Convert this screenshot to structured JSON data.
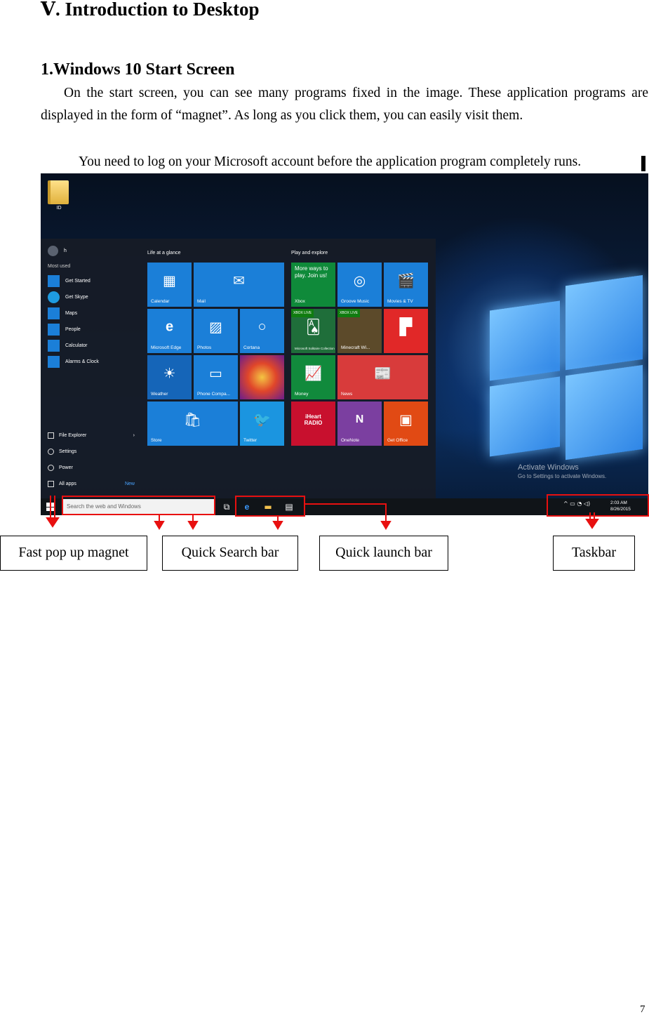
{
  "heading": "Ⅴ. Introduction to Desktop",
  "section_title": "1.Windows 10 Start Screen",
  "paragraph": "On the start screen, you can see many programs fixed in the image. These application programs are displayed in the form of “magnet”. As long as you click them, you can easily visit them.",
  "note": "You need to log on your Microsoft account before the application program completely runs.",
  "screenshot": {
    "desktop_icon_label": "ID",
    "user_name": "h",
    "most_used_title": "Most used",
    "most_used": [
      "Get Started",
      "Get Skype",
      "Maps",
      "People",
      "Calculator",
      "Alarms & Clock"
    ],
    "system_items": [
      "File Explorer",
      "Settings",
      "Power",
      "All apps"
    ],
    "new_label": "New",
    "group_life": "Life at a glance",
    "group_play": "Play and explore",
    "tiles": {
      "calendar": "Calendar",
      "mail": "Mail",
      "edge": "Microsoft Edge",
      "photos": "Photos",
      "cortana": "Cortana",
      "weather": "Weather",
      "phone": "Phone Compa...",
      "store": "Store",
      "twitter": "Twitter",
      "xbox_title": "More ways to play. Join us!",
      "xbox": "Xbox",
      "groove": "Groove Music",
      "movies": "Movies & TV",
      "solitaire": "Microsoft Solitaire Collection",
      "minecraft": "Minecraft Wi...",
      "money": "Money",
      "news": "News",
      "iheart": "iHeart RADIO",
      "onenote": "OneNote",
      "office": "Get Office",
      "xbox_live": "XBOX LIVE"
    },
    "search_placeholder": "Search the web and Windows",
    "activate_title": "Activate Windows",
    "activate_sub": "Go to Settings to activate Windows.",
    "clock_time": "2:03 AM",
    "clock_date": "8/26/2015"
  },
  "callouts": {
    "fast_popup": "Fast pop up magnet",
    "quick_search": "Quick Search bar",
    "quick_launch": "Quick launch bar",
    "taskbar": "Taskbar"
  },
  "page_number": "7",
  "colors": {
    "annotation_red": "#e81010",
    "tile_blue": "#1b7fd8",
    "tile_green": "#0f8a3a",
    "tile_red": "#d83b3b",
    "tile_purple": "#6b3fa0",
    "tile_orange": "#e14a14"
  }
}
